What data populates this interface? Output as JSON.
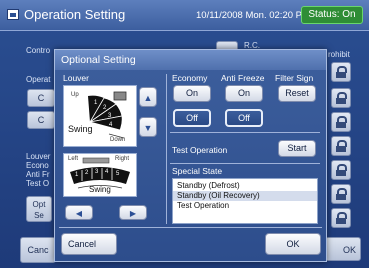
{
  "header": {
    "title": "Operation Setting",
    "datetime": "10/11/2008 Mon. 02:20 PM",
    "status": "Status: On",
    "status_color": "#2f8d36"
  },
  "background": {
    "control_label": "Contro",
    "rc_label": "R.C.",
    "prohibit_label": "rohibit",
    "operation_label": "Operat",
    "btn_c1": "C",
    "btn_c2": "C",
    "louver_label": "Louver",
    "economy_label": "Econo",
    "antifreeze_label": "Anti Fr",
    "test_label": "Test O",
    "opt_btn_line1": "Opt",
    "opt_btn_line2": "Se",
    "cancel_label": "Canc",
    "ok_label": "OK"
  },
  "dialog": {
    "title": "Optional Setting",
    "louver": {
      "label": "Louver",
      "up_label": "Up",
      "down_label": "Down",
      "swing_label": "Swing",
      "vertical_positions": [
        "1",
        "2",
        "3",
        "4"
      ],
      "left_label": "Left",
      "right_label": "Right",
      "horizontal_positions": [
        "1",
        "2",
        "3",
        "4",
        "5"
      ],
      "swing_label_h": "Swing"
    },
    "economy": {
      "label": "Economy",
      "on_label": "On",
      "off_label": "Off",
      "selected": "Off"
    },
    "anti_freeze": {
      "label": "Anti Freeze",
      "on_label": "On",
      "off_label": "Off",
      "selected": "Off"
    },
    "filter_sign": {
      "label": "Filter Sign",
      "reset_label": "Reset"
    },
    "test_operation": {
      "label": "Test Operation",
      "start_label": "Start"
    },
    "special_state": {
      "label": "Special State",
      "items": [
        "Standby (Defrost)",
        "Standby (Oil Recovery)",
        "Test Operation"
      ],
      "highlighted_index": 1
    },
    "cancel_label": "Cancel",
    "ok_label": "OK"
  }
}
